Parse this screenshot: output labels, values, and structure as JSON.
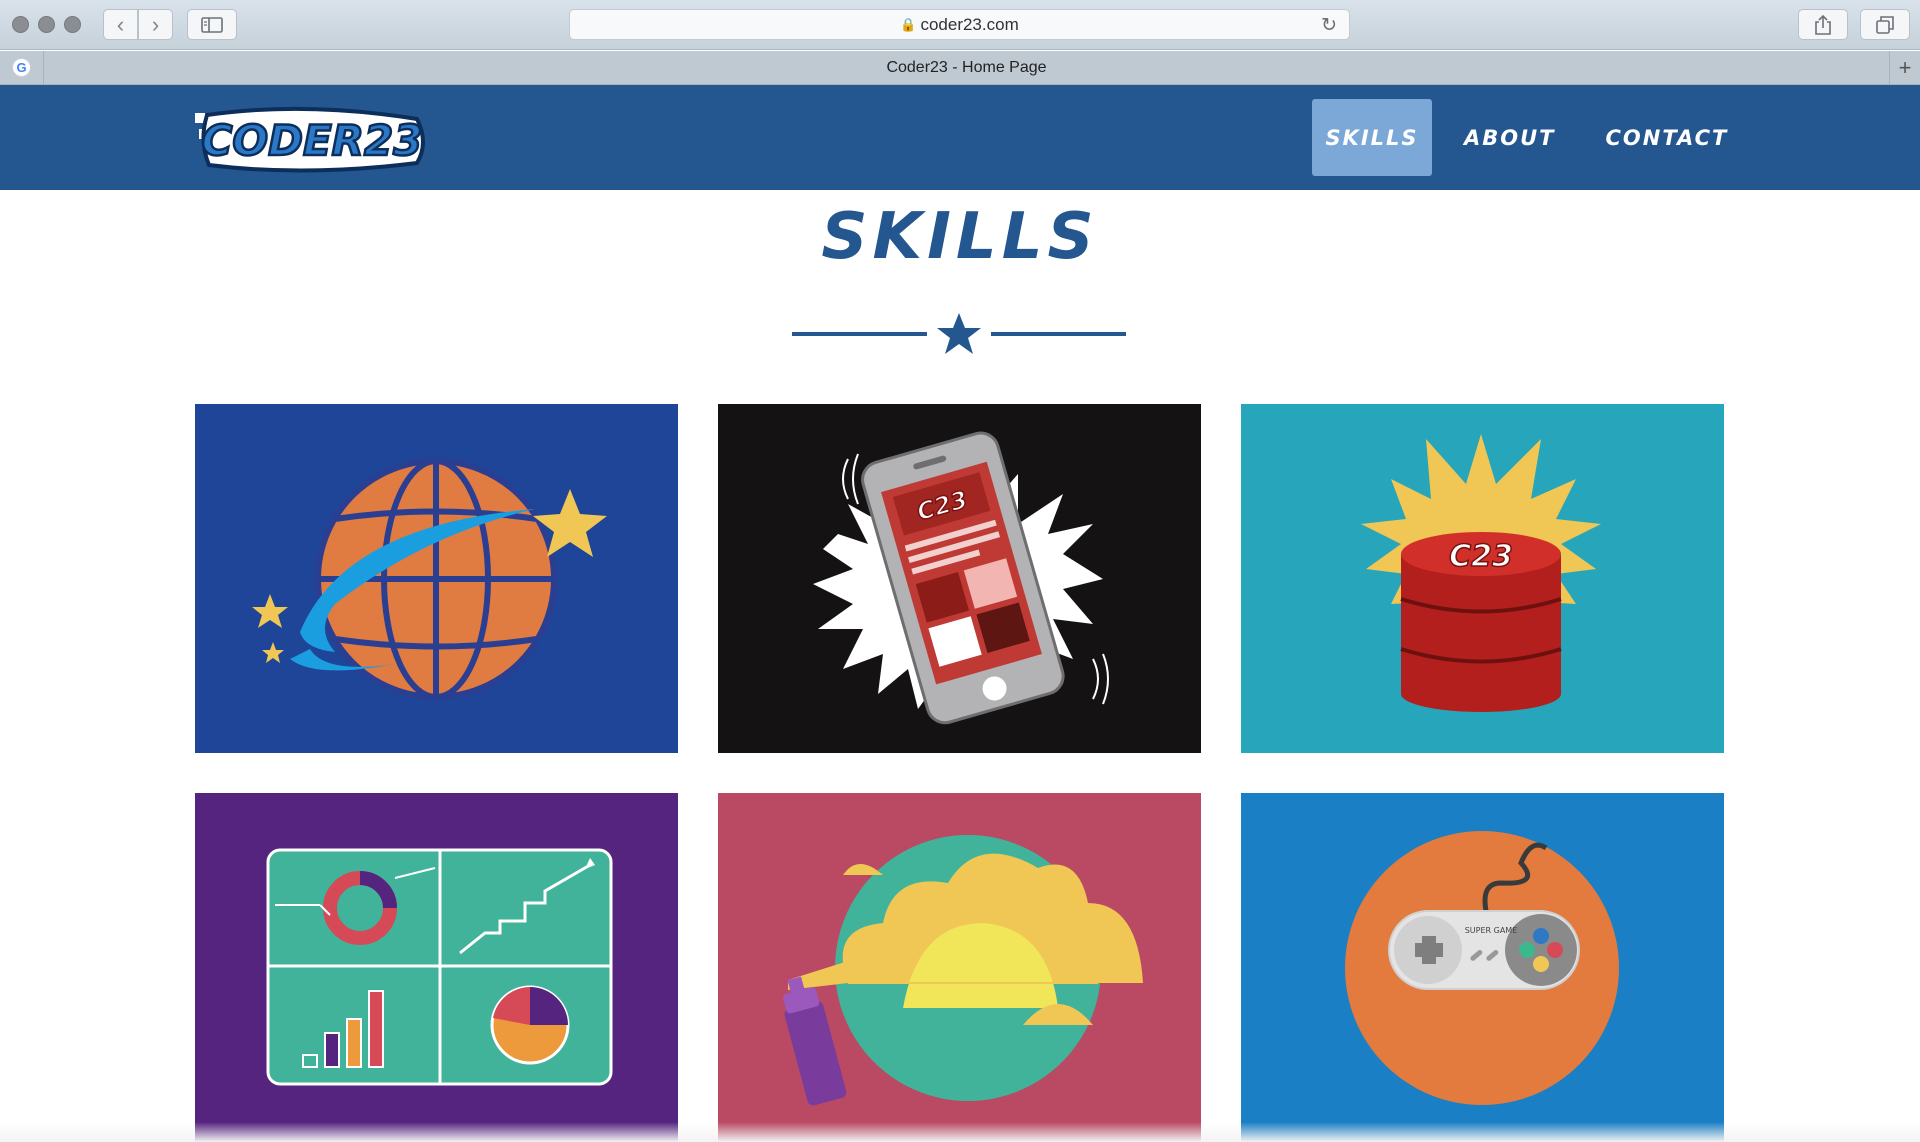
{
  "browser": {
    "url": "coder23.com",
    "tab_title": "Coder23 - Home Page",
    "favicon_letter": "G",
    "new_tab": "+"
  },
  "site": {
    "logo_text": "CODER23",
    "nav": [
      {
        "label": "SKILLS",
        "active": true
      },
      {
        "label": "ABOUT",
        "active": false
      },
      {
        "label": "CONTACT",
        "active": false
      }
    ],
    "section_title": "SKILLS"
  },
  "tiles": [
    {
      "name": "web-development",
      "background": "#1e4597",
      "badge": ""
    },
    {
      "name": "mobile-apps",
      "background": "#151213",
      "badge": "C23"
    },
    {
      "name": "databases",
      "background": "#27a5bb",
      "badge": "C23"
    },
    {
      "name": "analytics",
      "background": "#55247f",
      "badge": ""
    },
    {
      "name": "design",
      "background": "#ba4a64",
      "badge": ""
    },
    {
      "name": "games",
      "background": "#1a7fc4",
      "badge": "SUPER GAME"
    }
  ],
  "colors": {
    "header": "#245690",
    "nav_active": "#7ba8d6",
    "title": "#245690"
  }
}
